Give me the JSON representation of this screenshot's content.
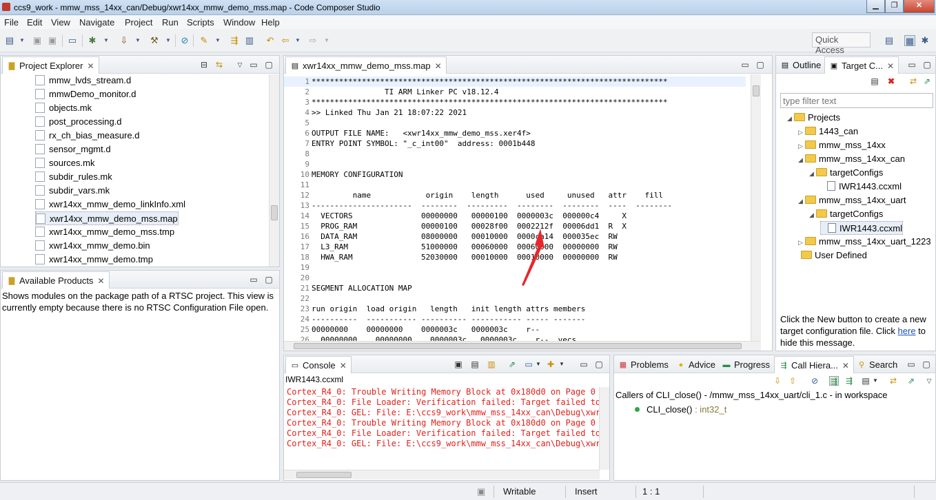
{
  "window": {
    "title": "ccs9_work - mmw_mss_14xx_can/Debug/xwr14xx_mmw_demo_mss.map - Code Composer Studio",
    "controls": [
      "minimize-icon",
      "maximize-icon",
      "close-icon"
    ]
  },
  "menu": [
    "File",
    "Edit",
    "View",
    "Navigate",
    "Project",
    "Run",
    "Scripts",
    "Window",
    "Help"
  ],
  "toolbar": {
    "quick_access": "Quick Access"
  },
  "project_explorer": {
    "tab_label": "Project Explorer",
    "items": [
      "mmw_lvds_stream.d",
      "mmwDemo_monitor.d",
      "objects.mk",
      "post_processing.d",
      "rx_ch_bias_measure.d",
      "sensor_mgmt.d",
      "sources.mk",
      "subdir_rules.mk",
      "subdir_vars.mk",
      "xwr14xx_mmw_demo_linkInfo.xml",
      "xwr14xx_mmw_demo_mss.map",
      "xwr14xx_mmw_demo_mss.tmp",
      "xwr14xx_mmw_demo.bin",
      "xwr14xx_mmw_demo.tmp"
    ],
    "selected_index": 10
  },
  "available_products": {
    "tab_label": "Available Products",
    "message": "Shows modules on the package path of a RTSC project. This view is currently empty because there is no RTSC Configuration File open."
  },
  "editor": {
    "tab_label": "xwr14xx_mmw_demo_mss.map",
    "lines": [
      {
        "n": "1",
        "t": "******************************************************************************"
      },
      {
        "n": "2",
        "t": "                TI ARM Linker PC v18.12.4"
      },
      {
        "n": "3",
        "t": "******************************************************************************"
      },
      {
        "n": "4",
        "t": ">> Linked Thu Jan 21 18:07:22 2021"
      },
      {
        "n": "5",
        "t": ""
      },
      {
        "n": "6",
        "t": "OUTPUT FILE NAME:   <xwr14xx_mmw_demo_mss.xer4f>"
      },
      {
        "n": "7",
        "t": "ENTRY POINT SYMBOL: \"_c_int00\"  address: 0001b448"
      },
      {
        "n": "8",
        "t": ""
      },
      {
        "n": "9",
        "t": ""
      },
      {
        "n": "10",
        "t": "MEMORY CONFIGURATION"
      },
      {
        "n": "11",
        "t": ""
      },
      {
        "n": "12",
        "t": "         name            origin    length      used     unused   attr    fill"
      },
      {
        "n": "13",
        "t": "----------------------  --------  ---------  --------  --------  ----  --------"
      },
      {
        "n": "14",
        "t": "  VECTORS               00000000   00000100  0000003c  000000c4     X"
      },
      {
        "n": "15",
        "t": "  PROG_RAM              00000100   00028f00  0002212f  00006dd1  R  X"
      },
      {
        "n": "16",
        "t": "  DATA_RAM              08000000   00010000  0000ca14  000035ec  RW"
      },
      {
        "n": "17",
        "t": "  L3_RAM                51000000   00060000  00060000  00000000  RW"
      },
      {
        "n": "18",
        "t": "  HWA_RAM               52030000   00010000  00010000  00000000  RW"
      },
      {
        "n": "19",
        "t": ""
      },
      {
        "n": "20",
        "t": ""
      },
      {
        "n": "21",
        "t": "SEGMENT ALLOCATION MAP"
      },
      {
        "n": "22",
        "t": ""
      },
      {
        "n": "23",
        "t": "run origin  load origin   length   init length attrs members"
      },
      {
        "n": "24",
        "t": "----------  ----------- ---------- ----------- ----- -------"
      },
      {
        "n": "25",
        "t": "00000000    00000000    0000003c   0000003c    r--"
      },
      {
        "n": "26",
        "t": "  00000000    00000000    0000003c   0000003c    r--  vecs"
      }
    ]
  },
  "console": {
    "tab_label": "Console",
    "source": "IWR1443.ccxml",
    "lines": [
      "Cortex_R4_0: Trouble Writing Memory Block at 0x180d0 on Page 0 of",
      "Cortex_R4_0: File Loader: Verification failed: Target failed to w",
      "Cortex_R4_0: GEL: File: E:\\ccs9_work\\mmw_mss_14xx_can\\Debug\\xwr14",
      "Cortex_R4_0: Trouble Writing Memory Block at 0x180d0 on Page 0 of",
      "Cortex_R4_0: File Loader: Verification failed: Target failed to w",
      "Cortex_R4_0: GEL: File: E:\\ccs9_work\\mmw_mss_14xx_can\\Debug\\xwr14"
    ]
  },
  "outline": {
    "tabs": [
      "Outline",
      "Target C..."
    ],
    "filter_placeholder": "type filter text",
    "projects_label": "Projects",
    "items": [
      {
        "label": "1443_can",
        "level": 1,
        "kind": "folder",
        "arrow": "▷"
      },
      {
        "label": "mmw_mss_14xx",
        "level": 1,
        "kind": "folder",
        "arrow": "▷"
      },
      {
        "label": "mmw_mss_14xx_can",
        "level": 1,
        "kind": "folder",
        "arrow": "◢"
      },
      {
        "label": "targetConfigs",
        "level": 2,
        "kind": "folder",
        "arrow": "◢"
      },
      {
        "label": "IWR1443.ccxml",
        "level": 3,
        "kind": "ccxml",
        "arrow": ""
      },
      {
        "label": "mmw_mss_14xx_uart",
        "level": 1,
        "kind": "folder",
        "arrow": "◢"
      },
      {
        "label": "targetConfigs",
        "level": 2,
        "kind": "folder",
        "arrow": "◢"
      },
      {
        "label": "IWR1443.ccxml",
        "level": 3,
        "kind": "ccxml",
        "arrow": "",
        "selected": true
      },
      {
        "label": "mmw_mss_14xx_uart_1223",
        "level": 1,
        "kind": "folder",
        "arrow": "▷"
      },
      {
        "label": "User Defined",
        "level": 0,
        "kind": "folder",
        "arrow": ""
      }
    ],
    "hint_prefix": "Click the New button to create a new target configuration file. Click ",
    "hint_link": "here",
    "hint_suffix": " to hide this message."
  },
  "bottom_right": {
    "tabs": [
      "Problems",
      "Advice",
      "Progress",
      "Call Hiera...",
      "Search"
    ],
    "callers_title": "Callers of CLI_close() - /mmw_mss_14xx_uart/cli_1.c - in workspace",
    "entry_name": "CLI_close()",
    "entry_type": " : int32_t"
  },
  "status": {
    "writable": "Writable",
    "insert": "Insert",
    "position": "1 : 1"
  },
  "colors": {
    "console_error": "#e2221b",
    "annotation_arrow": "#e8262b"
  }
}
